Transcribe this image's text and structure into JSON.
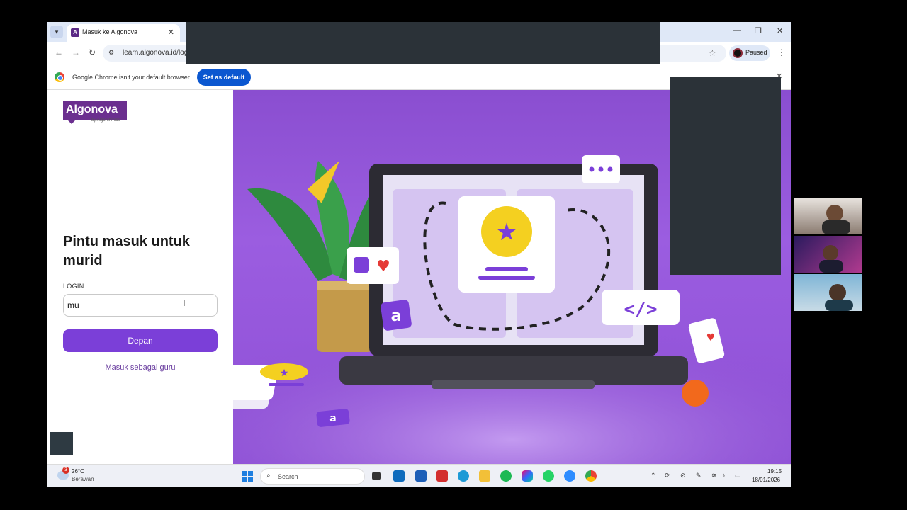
{
  "browser": {
    "tab_title": "Masuk ke Algonova",
    "url": "learn.algonova.id/log",
    "profile_status": "Paused",
    "infobar_text": "Google Chrome isn't your default browser",
    "set_default_label": "Set as default"
  },
  "login": {
    "logo_text": "Algonova",
    "logo_sub": "by Algorithmics",
    "title": "Pintu masuk untuk murid",
    "label": "LOGIN",
    "input_value": "mu",
    "submit_label": "Depan",
    "teacher_link": "Masuk sebagai guru"
  },
  "taskbar": {
    "weather_temp": "26°C",
    "weather_condition": "Berawan",
    "weather_badge": "3",
    "search_label": "Search",
    "time": "19:15",
    "date": "18/01/2026"
  },
  "colors": {
    "brand": "#6b2f8f",
    "button": "#7b3fd8",
    "hero_bg": "#9b5de0",
    "chrome_blue": "#0b57d0"
  }
}
